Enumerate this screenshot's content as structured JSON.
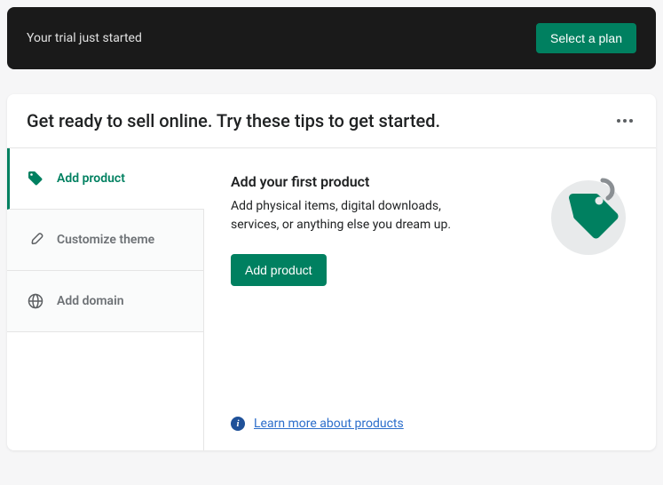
{
  "banner": {
    "text": "Your trial just started",
    "button": "Select a plan"
  },
  "card": {
    "title": "Get ready to sell online. Try these tips to get started."
  },
  "sidebar": {
    "items": [
      {
        "label": "Add product"
      },
      {
        "label": "Customize theme"
      },
      {
        "label": "Add domain"
      }
    ]
  },
  "content": {
    "heading": "Add your first product",
    "description": "Add physical items, digital downloads, services, or anything else you dream up.",
    "button": "Add product",
    "learn_more": "Learn more about products"
  },
  "colors": {
    "primary": "#008060",
    "link": "#2c6ecb"
  }
}
